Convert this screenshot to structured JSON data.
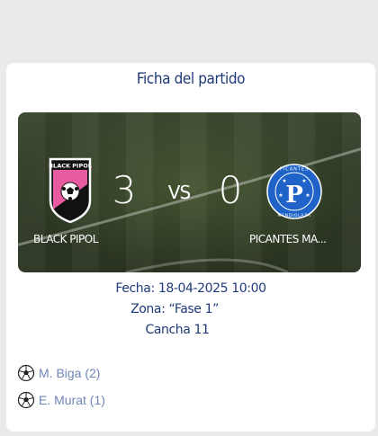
{
  "card": {
    "title": "Ficha del partido"
  },
  "match": {
    "home": {
      "name": "BLACK PIPOL",
      "score": "3",
      "logo_text": "BLACK PIPOL"
    },
    "vs_label": "VS",
    "away": {
      "name": "PICANTES MA...",
      "score": "0",
      "logo_letter": "P",
      "logo_ring_text_top": "PICANTES",
      "logo_ring_text_bottom": "MENDIOLAZA"
    }
  },
  "details": {
    "date": "Fecha: 18-04-2025 10:00",
    "zone": "Zona: “Fase 1”",
    "field": "Cancha 11"
  },
  "scorers": [
    {
      "label": "M. Biga (2)",
      "icon": "soccer-ball-icon"
    },
    {
      "label": "E. Murat (1)",
      "icon": "soccer-ball-icon"
    }
  ],
  "colors": {
    "title": "#1f3a78",
    "scorer_text": "#6f86b6",
    "home_pink": "#e85ba0",
    "away_blue": "#1f63c8"
  }
}
